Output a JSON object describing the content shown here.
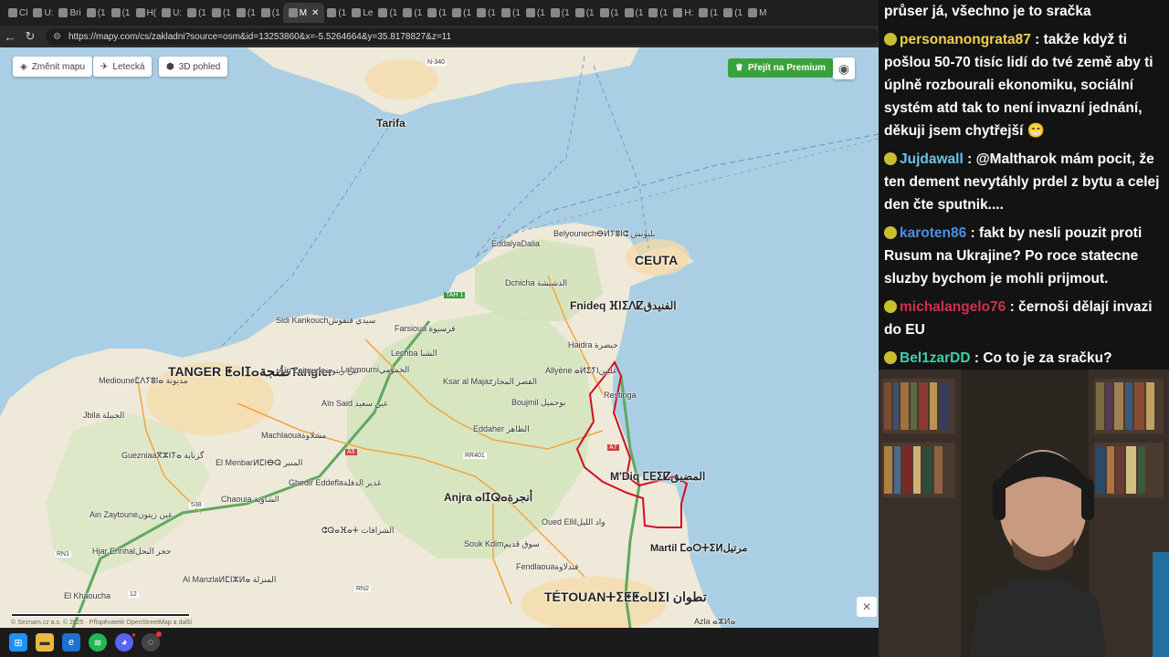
{
  "browser": {
    "tabs": [
      "Cl",
      "U:",
      "Bri",
      "(1",
      "(1",
      "H(",
      "U:",
      "(1",
      "(1",
      "(1",
      "(1",
      "M",
      "(1",
      "Le",
      "(1",
      "(1",
      "(1",
      "(1",
      "(1",
      "(1",
      "(1",
      "(1",
      "(1",
      "(1",
      "(1",
      "(1",
      "H:",
      "(1",
      "(1",
      "M"
    ],
    "active_tab": "M",
    "url": "https://mapy.com/cs/zakladni?source=osm&id=13253860&x=-5.5264664&y=35.8178827&z=11"
  },
  "map_controls": {
    "change_map": "Změnit mapu",
    "aerial": "Letecká",
    "view_3d": "3D pohled",
    "premium": "Přejít na Premium"
  },
  "map_labels": {
    "tarifa": "Tarifa",
    "n340": "N-340",
    "ceuta": "CEUTA",
    "eddalya": "Eddalya",
    "eddalya_ar": "Dalia",
    "belyounech": "Belyounech",
    "belyounech_ar": "ⴱⵍⵢⵓⵏⵛ بليونش",
    "dchicha": "Dchicha الدشيشة",
    "fnideq": "Fnideq ⴼⵏⵉⴷⵇ",
    "fnideq_ar": "الفنيدق",
    "sidi_kankouch": "Sidi Kankouch",
    "sidi_kankouch_ar": "سيدي قنقوش",
    "farsioua": "Farsioua فرسيوة",
    "haidra": "Haidra حيضرة",
    "tanger": "TANGER ⵟⴰⵏⵊⴰ",
    "tanger_ar": "طنجة",
    "tangier": "Tangier",
    "lechba": "Lechba الشبا",
    "ain_zeitoune": "Aïn Zeitoune",
    "ain_zeitoune_ar": "عين زيتونة",
    "lahmoumi": "Lahmoumi",
    "lahmoumi_ar": "الحمومي",
    "ksar_al_majaz": "Ksar al Majaz",
    "ksar_al_majaz_ar": "القصر المجاز",
    "allyene": "Allyène ⴰⵍⵉⵢⵏ",
    "allyene_ar": "عليين",
    "restinga": "Restinga",
    "medioun": "Medioune",
    "medioun_ar": "ⵎⴷⵢⵓⵏⴰ مديونة",
    "ain_said": "Aïn Said عين سعيد",
    "boujmil": "Boujmil بوجميل",
    "jbila": "Jbila الجبيلة",
    "machlaoua": "Machlaoua",
    "machlaoua_ar": "مشلاوة",
    "eddaher": "Eddaher الظاهر",
    "guezniaa": "Guezniaa",
    "guezniaa_ar": "ⴳⵣⵏⵢⴰ گزنایة",
    "el_menbar": "El Menbar",
    "el_menbar_ar": "ⵍⵎⵏⴱⵕ المنبر",
    "a5": "A5",
    "rr401": "RR401",
    "a7": "A7",
    "mdiq": "M'Diq ⵎⴹⵉⵇ",
    "mdiq_ar": "المضيق",
    "ghedir": "Ghedir Eddefla",
    "ghedir_ar": "غدير الدفلة",
    "chaouia": "Chaouia الشاوية",
    "anjra": "Anjra ⴰⵏⵊⵕⴰ",
    "anjra_ar": "أنجرة",
    "ain_zaytoune": "Ain Zaytoune",
    "ain_zaytoune_ar": "عين زيتون",
    "chrafat": "ⵛⵕⴰⴼⴰⵜ الشرافات",
    "oued_elil": "Oued Ellil",
    "oued_elil_ar": "واد الليل",
    "martil": "Martil ⵎⴰⵔⵜⵉⵍ",
    "martil_ar": "مرتيل",
    "hjar_ennhal": "Hjar Ennhal",
    "hjar_ennhal_ar": "حجر النحل",
    "souk_kdim": "Souk Kdim",
    "souk_kdim_ar": "سوق قديم",
    "fendlaoua": "Fendlaoua",
    "fendlaoua_ar": "فندلاوة",
    "al_manzla": "Al Manzla",
    "al_manzla_ar": "ⵍⵎⵏⵣⵍⴰ المنزلة",
    "el_khaoucha": "El Khaoucha",
    "tetouan": "TÉTOUAN",
    "tetouan_ar": "ⵜⵉⵟⵟⴰⵡⵉⵏ تطوان",
    "azla": "Azla ⴰⵣⵍⴰ",
    "rn1": "RN1",
    "rn2": "RN2",
    "n538": "538",
    "n12": "12",
    "tah1": "TAH 1"
  },
  "map_footer": {
    "copyright": "© Seznam.cz a.s. © 2025 · Přispěvatelé OpenStreetMap a další"
  },
  "taskbar": {
    "discord_badge": "●"
  },
  "chat": {
    "messages": [
      {
        "user": "",
        "text": "průser já, všechno je to sračka",
        "color": "#ffffff"
      },
      {
        "user": "personanongrata87",
        "text": "takže když ti pošlou 50-70 tisíc lidí do tvé země aby ti úplně rozbourali ekonomiku, sociální systém atd tak to není invazní jednání, děkuji jsem chytřejší 😁",
        "color": "#f0d050"
      },
      {
        "user": "Jujdawall",
        "text": "@Maltharok mám pocit, že ten dement nevytáhly prdel z bytu a celej den čte sputnik....",
        "color": "#66c4e8",
        "mention": "@Maltharok"
      },
      {
        "user": "karoten86",
        "text": "fakt by nesli pouzit proti Rusum na Ukrajine? Po roce statecne sluzby bychom je mohli prijmout.",
        "color": "#4a8fe8"
      },
      {
        "user": "michalangelo76",
        "text": "černoši dělají invazi do EU",
        "color": "#d0304a"
      },
      {
        "user": "Bel1zarDD",
        "text": "Co to je za sračku?",
        "color": "#3ed0a8"
      }
    ]
  },
  "colors": {
    "premium_green": "#3aa23a",
    "boundary_red": "#d01020",
    "sea": "#aacfe5",
    "land": "#eee9d8"
  }
}
